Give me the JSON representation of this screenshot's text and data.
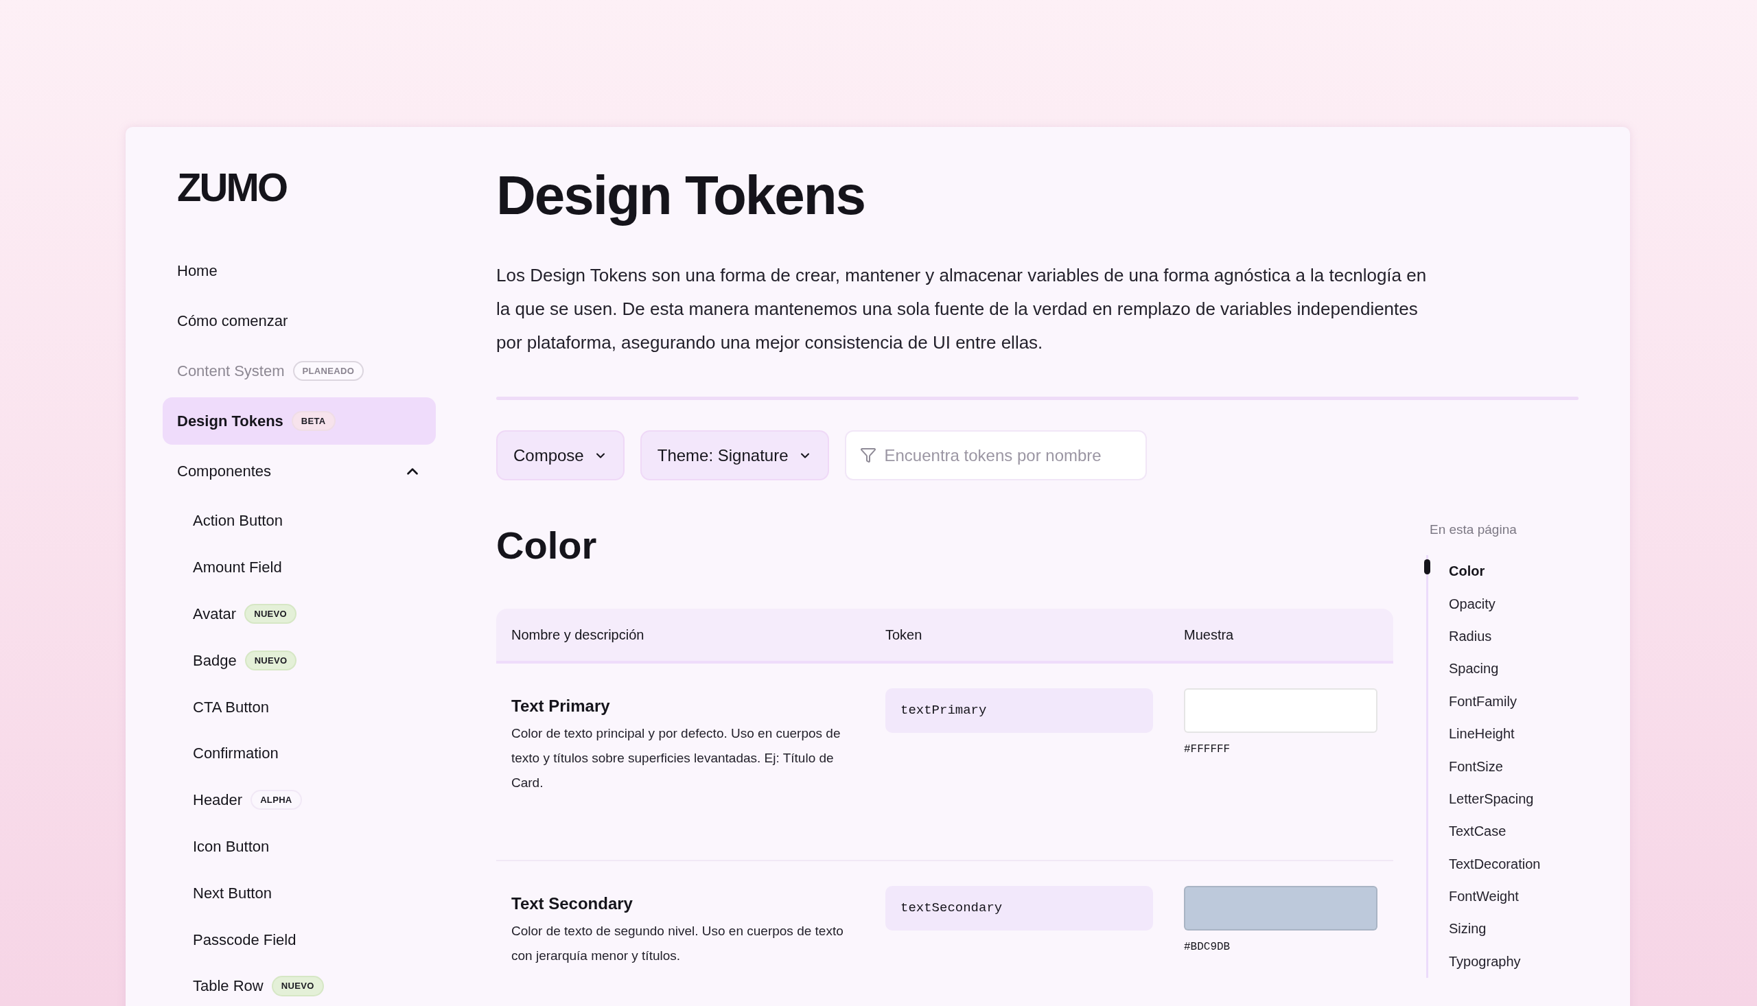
{
  "brand": {
    "logo": "ZUMO"
  },
  "sidebar": {
    "items": [
      {
        "label": "Home",
        "selected": false,
        "disabled": false
      },
      {
        "label": "Cómo comenzar",
        "selected": false,
        "disabled": false
      },
      {
        "label": "Content System",
        "selected": false,
        "disabled": true,
        "badge": {
          "text": "PLANEADO",
          "kind": "planned"
        }
      },
      {
        "label": "Design Tokens",
        "selected": true,
        "disabled": false,
        "badge": {
          "text": "BETA",
          "kind": "beta"
        }
      },
      {
        "label": "Componentes",
        "selected": false,
        "disabled": false,
        "expanded": true,
        "children": [
          {
            "label": "Action Button",
            "selected": false
          },
          {
            "label": "Amount Field",
            "selected": false
          },
          {
            "label": "Avatar",
            "selected": false,
            "badge": {
              "text": "NUEVO",
              "kind": "new"
            }
          },
          {
            "label": "Badge",
            "selected": false,
            "badge": {
              "text": "NUEVO",
              "kind": "new"
            }
          },
          {
            "label": "CTA Button",
            "selected": false
          },
          {
            "label": "Confirmation",
            "selected": false
          },
          {
            "label": "Header",
            "selected": false,
            "badge": {
              "text": "ALPHA",
              "kind": "alpha"
            }
          },
          {
            "label": "Icon Button",
            "selected": false
          },
          {
            "label": "Next Button",
            "selected": false
          },
          {
            "label": "Passcode Field",
            "selected": false
          },
          {
            "label": "Table Row",
            "selected": false,
            "badge": {
              "text": "NUEVO",
              "kind": "new"
            }
          }
        ]
      }
    ]
  },
  "page": {
    "title": "Design Tokens",
    "intro": "Los Design Tokens son una forma de crear, mantener y almacenar variables de una forma agnóstica a la tecnlogía en la que se usen. De esta manera mantenemos una sola fuente de la verdad en remplazo de variables independientes por plataforma, asegurando una mejor consistencia de UI entre ellas."
  },
  "filters": [
    {
      "kind": "dropdown",
      "label": "Compose"
    },
    {
      "kind": "dropdown",
      "label": "Theme: Signature"
    },
    {
      "kind": "search",
      "placeholder": "Encuentra tokens por nombre"
    }
  ],
  "section": {
    "heading": "Color",
    "table": {
      "columns": [
        "Nombre y descripción",
        "Token",
        "Muestra"
      ],
      "rows": [
        {
          "name": "Text Primary",
          "description": "Color de texto principal y por defecto. Uso en cuerpos de texto y títulos sobre superficies levantadas. Ej: Título de Card.",
          "token": "textPrimary",
          "color": "#ffffff",
          "hex": "#FFFFFF"
        },
        {
          "name": "Text Secondary",
          "description": "Color de texto de segundo nivel. Uso en cuerpos de texto con jerarquía menor y títulos.",
          "token": "textSecondary",
          "color": "#bdc9db",
          "hex": "#BDC9DB"
        }
      ]
    }
  },
  "toc": {
    "title": "En esta página",
    "items": [
      {
        "label": "Color",
        "selected": true
      },
      {
        "label": "Opacity",
        "selected": false
      },
      {
        "label": "Radius",
        "selected": false
      },
      {
        "label": "Spacing",
        "selected": false
      },
      {
        "label": "FontFamily",
        "selected": false
      },
      {
        "label": "LineHeight",
        "selected": false
      },
      {
        "label": "FontSize",
        "selected": false
      },
      {
        "label": "LetterSpacing",
        "selected": false
      },
      {
        "label": "TextCase",
        "selected": false
      },
      {
        "label": "TextDecoration",
        "selected": false
      },
      {
        "label": "FontWeight",
        "selected": false
      },
      {
        "label": "Sizing",
        "selected": false
      },
      {
        "label": "Typography",
        "selected": false
      }
    ]
  }
}
